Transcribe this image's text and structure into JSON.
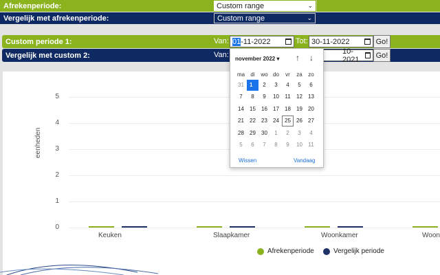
{
  "period": {
    "label": "Afrekenperiode:",
    "value": "Custom range"
  },
  "compare_period": {
    "label": "Vergelijk met afrekenperiode:",
    "value": "Custom range"
  },
  "custom1": {
    "label": "Custom periode 1:",
    "van_label": "Van:",
    "van_day": "01",
    "van_rest": "-11-2022",
    "tot_label": "Tot:",
    "tot_value": "30-11-2022",
    "go_label": "Go!"
  },
  "custom2": {
    "label": "Vergelijk met custom 2:",
    "van_label": "Van:",
    "tot_value_visible": "10-2021",
    "go_label": "Go!"
  },
  "calendar": {
    "month_label": "november 2022",
    "month_arrow": "▾",
    "prev": "↑",
    "next": "↓",
    "weekdays": [
      "ma",
      "di",
      "wo",
      "do",
      "vr",
      "za",
      "zo"
    ],
    "weeks": [
      [
        "31",
        "1",
        "2",
        "3",
        "4",
        "5",
        "6"
      ],
      [
        "7",
        "8",
        "9",
        "10",
        "11",
        "12",
        "13"
      ],
      [
        "14",
        "15",
        "16",
        "17",
        "18",
        "19",
        "20"
      ],
      [
        "21",
        "22",
        "23",
        "24",
        "25",
        "26",
        "27"
      ],
      [
        "28",
        "29",
        "30",
        "1",
        "2",
        "3",
        "4"
      ],
      [
        "5",
        "6",
        "7",
        "8",
        "9",
        "10",
        "11"
      ]
    ],
    "selected": "1",
    "today": "25",
    "clear_label": "Wissen",
    "today_label": "Vandaag"
  },
  "chart_data": {
    "type": "bar",
    "categories": [
      "Keuken",
      "Slaapkamer",
      "Woonkamer",
      "Woon"
    ],
    "series": [
      {
        "name": "Afrekenperiode",
        "color": "#8ab31e",
        "values": [
          0,
          0,
          0,
          0
        ]
      },
      {
        "name": "Vergelijk periode",
        "color": "#1e3166",
        "values": [
          0,
          0,
          0,
          0
        ]
      }
    ],
    "yticks": [
      "0",
      "1",
      "2",
      "3",
      "4",
      "5"
    ],
    "ylabel": "eenheden",
    "ylim": [
      0,
      5
    ]
  },
  "colors": {
    "green": "#8ab31e",
    "navy": "#0f2a63",
    "accent": "#1a73e8"
  }
}
